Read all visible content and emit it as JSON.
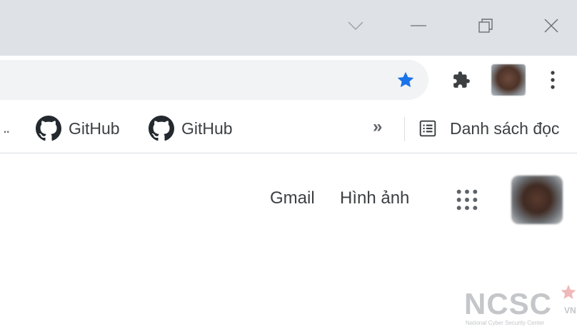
{
  "window_controls": {
    "dropdown_icon": "chevron-down-icon",
    "minimize_icon": "minimize-icon",
    "restore_icon": "restore-icon",
    "close_icon": "close-icon"
  },
  "toolbar": {
    "star_icon": "bookmark-star-icon",
    "star_color": "#1a73e8",
    "extensions_icon": "puzzle-icon",
    "menu_icon": "kebab-menu-icon"
  },
  "bookmarks": {
    "overflow_left": "..",
    "items": [
      {
        "label": "GitHub",
        "icon": "github-icon"
      },
      {
        "label": "GitHub",
        "icon": "github-icon"
      }
    ],
    "more_chevron": "»",
    "reading_list": {
      "label": "Danh sách đọc",
      "icon": "reading-list-icon"
    }
  },
  "page": {
    "gmail_label": "Gmail",
    "images_label": "Hình ảnh",
    "apps_icon": "apps-grid-icon"
  },
  "watermark": {
    "main": "NCSC",
    "suffix": "VN",
    "sub": "National Cyber Security Center"
  }
}
